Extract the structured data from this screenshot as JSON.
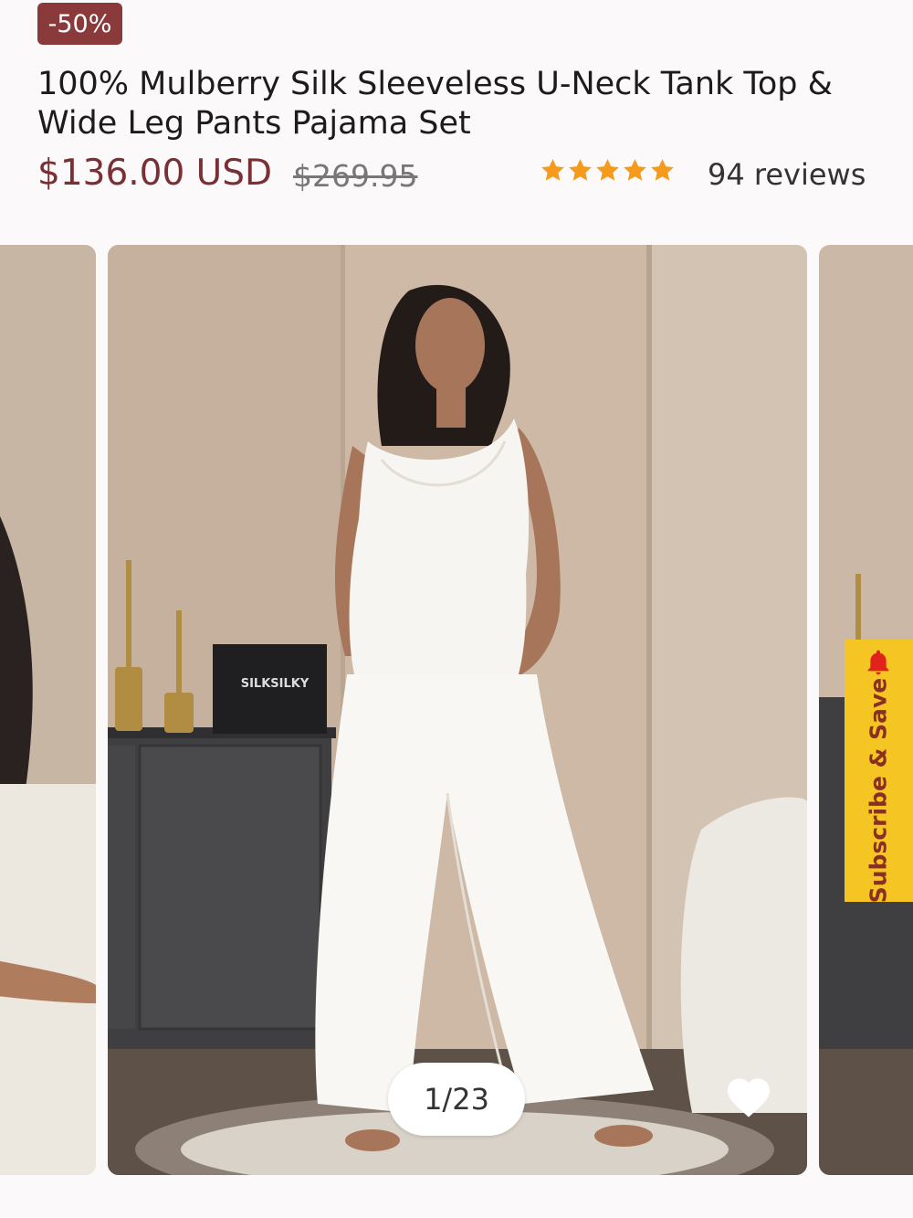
{
  "badge": {
    "discount": "-50%"
  },
  "product": {
    "title": "100% Mulberry Silk Sleeveless U-Neck Tank Top & Wide Leg Pants Pajama Set",
    "price": "$136.00 USD",
    "old_price": "$269.95",
    "rating": 5,
    "reviews": "94 reviews"
  },
  "carousel": {
    "counter": "1/23",
    "brand_on_box": "SILKSILKY"
  },
  "subscribe": {
    "label": "Subscribe & Save"
  },
  "colors": {
    "accent": "#7a2f35",
    "badge": "#8a3a3a",
    "star": "#f59a1b",
    "subscribe_bg": "#f5c623",
    "subscribe_text": "#8a2f23"
  },
  "icons": [
    "star-icon",
    "heart-icon",
    "bell-icon"
  ]
}
